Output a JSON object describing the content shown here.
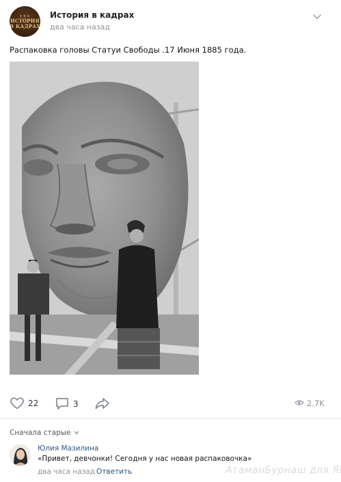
{
  "header": {
    "group_name": "История в кадрах",
    "time": "два часа назад",
    "logo": {
      "stars": "★★★",
      "line1": "ИСТОРИЯ",
      "line2": "В КАДРАХ"
    }
  },
  "post": {
    "text": "Распаковка головы Статуи Свободы .17 Июня 1885 года."
  },
  "actions": {
    "likes": "22",
    "comments": "3",
    "views": "2.7K"
  },
  "comments_section": {
    "sort_label": "Сначала старые",
    "comment": {
      "author": "Юлия Мазилина",
      "text": "«Привет, девчонки! Сегодня у нас новая распаковочка»",
      "time": "два часа назад",
      "reply_label": "Ответить"
    }
  },
  "watermark": "АтаманБурнаш для ЯП",
  "colors": {
    "link": "#2a5885",
    "meta": "#939393",
    "icon": "#828a99",
    "divider": "#e7e8ec"
  }
}
